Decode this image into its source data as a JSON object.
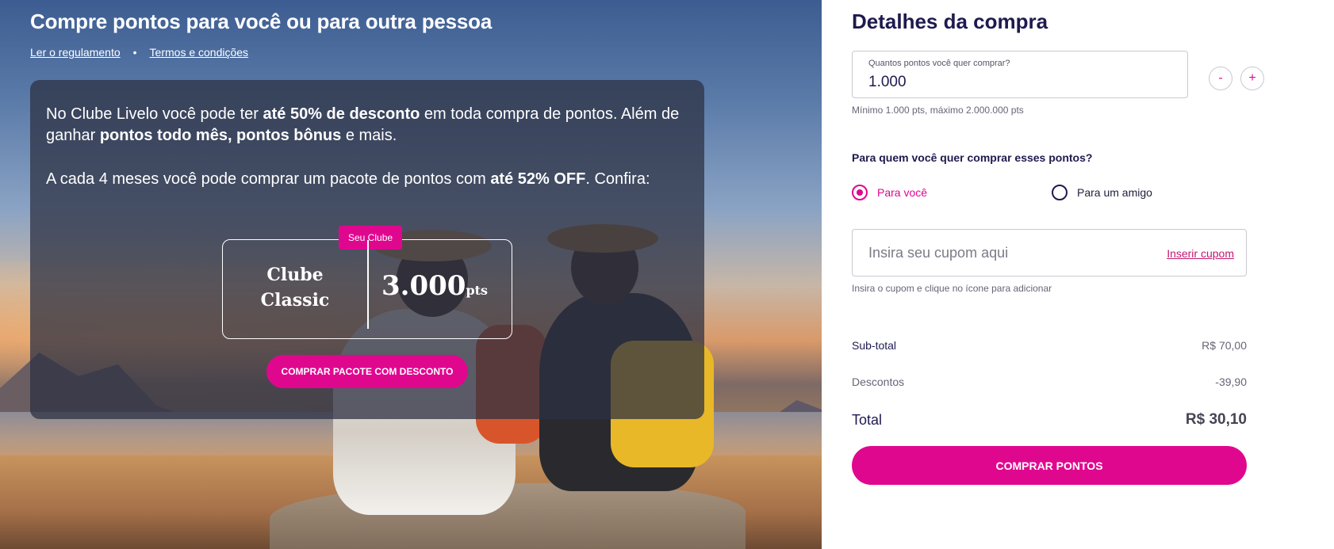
{
  "hero": {
    "title": "Compre pontos para você ou para outra pessoa",
    "links": {
      "regulation": "Ler o regulamento",
      "separator": "•",
      "terms": "Termos e condições"
    },
    "promo": {
      "p1_a": "No Clube Livelo você pode ter ",
      "p1_b": "até 50% de desconto",
      "p1_c": " em toda compra de pontos. Além de ganhar ",
      "p1_d": "pontos todo mês, pontos bônus",
      "p1_e": " e mais.",
      "p2_a": "A cada 4 meses você pode comprar um pacote de pontos com ",
      "p2_b": "até 52% OFF",
      "p2_c": ". Confira:"
    },
    "club": {
      "tag": "Seu Clube",
      "name_line1": "Clube",
      "name_line2": "Classic",
      "points": "3.000",
      "unit": "pts"
    },
    "button": "COMPRAR PACOTE COM DESCONTO"
  },
  "panel": {
    "title": "Detalhes da compra",
    "quantity": {
      "label": "Quantos pontos você quer comprar?",
      "value": "1.000",
      "minus": "-",
      "plus": "+",
      "help": "Mínimo 1.000 pts, máximo 2.000.000 pts"
    },
    "recipient": {
      "question": "Para quem você quer comprar esses pontos?",
      "options": [
        {
          "label": "Para você",
          "selected": true
        },
        {
          "label": "Para um amigo",
          "selected": false
        }
      ]
    },
    "coupon": {
      "placeholder": "Insira seu cupom aqui",
      "link": "Inserir cupom",
      "help": "Insira o cupom e clique no ícone para adicionar"
    },
    "summary": {
      "subtotal_label": "Sub-total",
      "subtotal_value": "R$ 70,00",
      "discount_label": "Descontos",
      "discount_value": "-39,90",
      "total_label": "Total",
      "total_value": "R$ 30,10"
    },
    "buy_button": "COMPRAR PONTOS"
  },
  "colors": {
    "accent": "#e0078f",
    "heading": "#1e1a4f",
    "card_overlay": "#2c3042"
  }
}
